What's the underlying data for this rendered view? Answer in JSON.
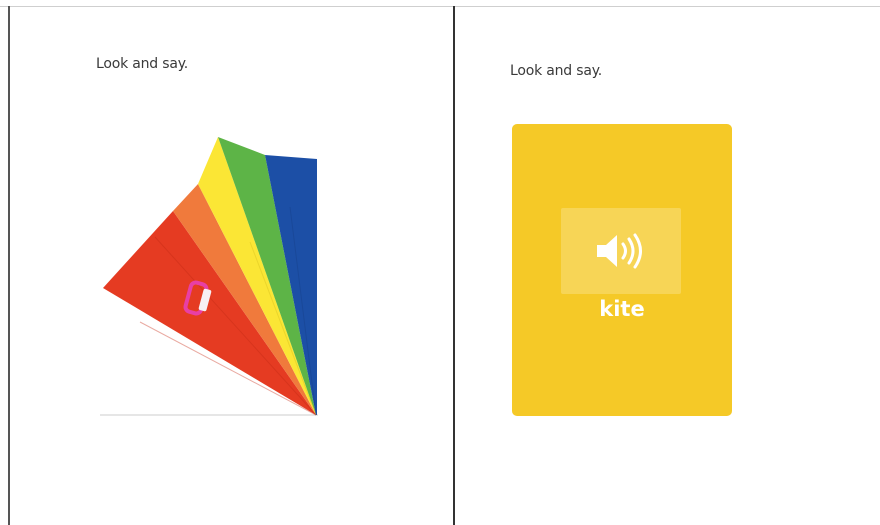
{
  "left_panel": {
    "instruction": "Look and say."
  },
  "right_panel": {
    "instruction": "Look and say.",
    "card": {
      "word": "kite",
      "color": "#f5c927",
      "audio_icon": "speaker-icon"
    }
  },
  "kite": {
    "icon": "kite-image",
    "colors": [
      "#e53b22",
      "#f07a3c",
      "#fbe635",
      "#5db447",
      "#1c4fa6"
    ],
    "handle_color": "#e83fa6"
  }
}
